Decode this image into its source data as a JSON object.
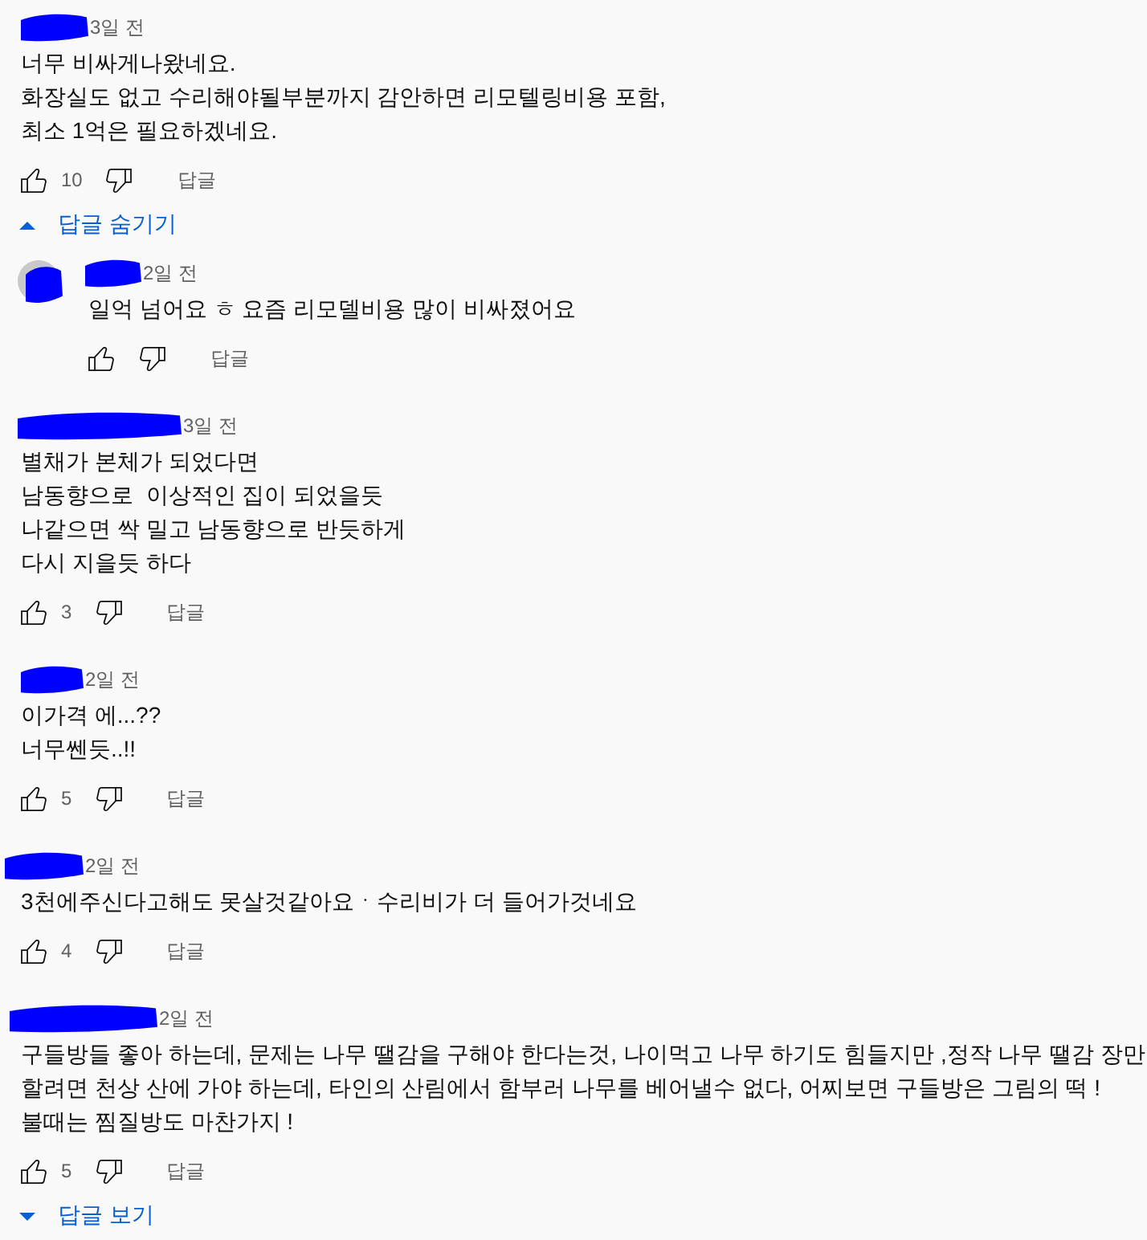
{
  "comments": [
    {
      "time": "3일 전",
      "body": [
        "너무 비싸게나왔네요.",
        "화장실도 없고 수리해야될부분까지 감안하면 리모텔링비용 포함,",
        "최소 1억은 필요하겠네요."
      ],
      "likes": "10",
      "reply_button": "답글",
      "replies_toggle": {
        "label": "답글 숨기기",
        "expanded": true
      },
      "replies": [
        {
          "time": "2일 전",
          "body": [
            "일억 넘어요 ㅎ 요즘 리모델비용 많이 비싸졌어요"
          ],
          "reply_button": "답글"
        }
      ]
    },
    {
      "time": "3일 전",
      "body": [
        "별채가 본체가 되었다면",
        "남동향으로  이상적인 집이 되었을듯",
        "나같으면 싹 밀고 남동향으로 반듯하게",
        "다시 지을듯 하다"
      ],
      "likes": "3",
      "reply_button": "답글"
    },
    {
      "time": "2일 전",
      "body": [
        "이가격 에...??",
        "너무쎈듯..!!"
      ],
      "likes": "5",
      "reply_button": "답글"
    },
    {
      "time": "2일 전",
      "body": [
        "3천에주신다고해도 못살것같아요ㆍ수리비가 더 들어가것네요"
      ],
      "likes": "4",
      "reply_button": "답글"
    },
    {
      "time": "2일 전",
      "body": [
        "구들방들 좋아 하는데, 문제는 나무 땔감을 구해야 한다는것, 나이먹고 나무 하기도 힘들지만 ,정작 나무 땔감 장만",
        "할려면 천상 산에 가야 하는데, 타인의 산림에서 함부러 나무를 베어낼수 없다, 어찌보면 구들방은 그림의 떡 !",
        "불때는 찜질방도 마찬가지 !"
      ],
      "likes": "5",
      "reply_button": "답글",
      "replies_toggle": {
        "label": "답글 보기",
        "expanded": false
      }
    }
  ]
}
